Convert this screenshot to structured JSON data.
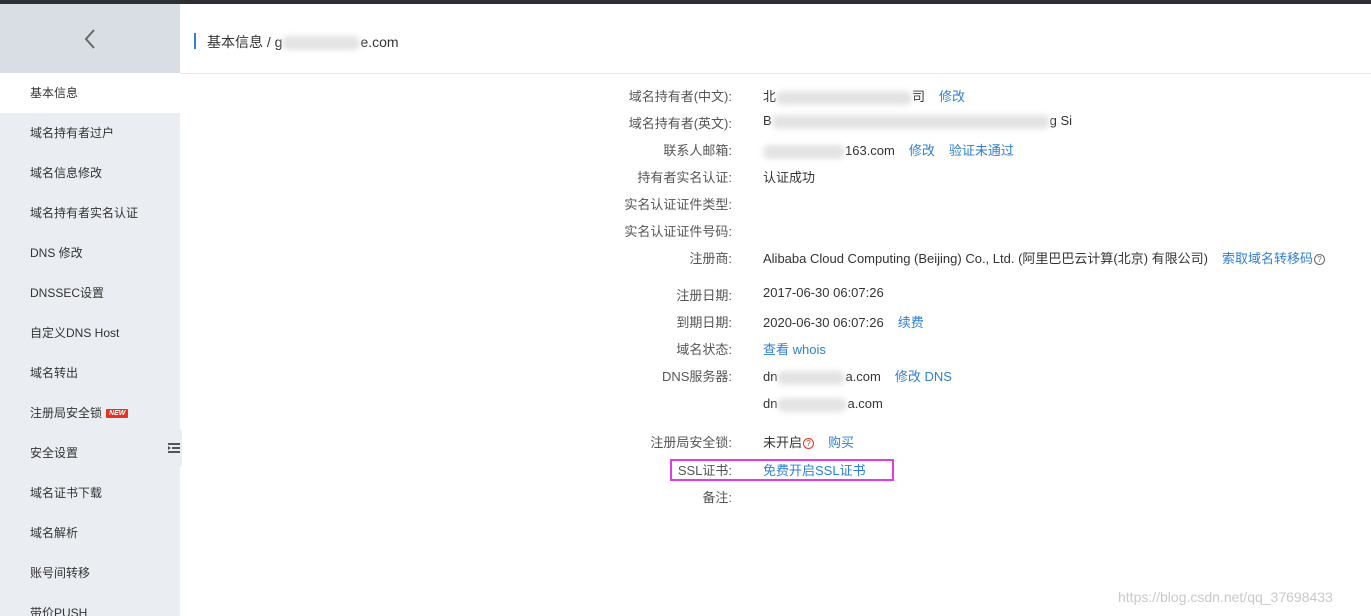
{
  "sidebar": {
    "items": [
      {
        "label": "基本信息"
      },
      {
        "label": "域名持有者过户"
      },
      {
        "label": "域名信息修改"
      },
      {
        "label": "域名持有者实名认证"
      },
      {
        "label": "DNS 修改"
      },
      {
        "label": "DNSSEC设置"
      },
      {
        "label": "自定义DNS Host"
      },
      {
        "label": "域名转出"
      },
      {
        "label": "注册局安全锁",
        "badge": "NEW"
      },
      {
        "label": "安全设置"
      },
      {
        "label": "域名证书下载"
      },
      {
        "label": "域名解析"
      },
      {
        "label": "账号间转移"
      },
      {
        "label": "带价PUSH"
      }
    ]
  },
  "header": {
    "breadcrumb_root": "基本信息",
    "separator": "/",
    "domain_prefix": "g",
    "domain_suffix": "e.com"
  },
  "info": {
    "owner_cn": {
      "label": "域名持有者(中文):",
      "prefix": "北",
      "suffix": "司",
      "action": "修改"
    },
    "owner_en": {
      "label": "域名持有者(英文):",
      "prefix": "B",
      "suffix": "g Si"
    },
    "email": {
      "label": "联系人邮箱:",
      "suffix": "163.com",
      "action1": "修改",
      "action2": "验证未通过"
    },
    "realname": {
      "label": "持有者实名认证:",
      "value": "认证成功"
    },
    "cert_type": {
      "label": "实名认证证件类型:"
    },
    "cert_no": {
      "label": "实名认证证件号码:"
    },
    "registrar": {
      "label": "注册商:",
      "value": "Alibaba Cloud Computing (Beijing) Co., Ltd. (阿里巴巴云计算(北京) 有限公司)",
      "action": "索取域名转移码"
    },
    "reg_date": {
      "label": "注册日期:",
      "value": "2017-06-30 06:07:26"
    },
    "exp_date": {
      "label": "到期日期:",
      "value": "2020-06-30 06:07:26",
      "action": "续费"
    },
    "status": {
      "label": "域名状态:",
      "action": "查看 whois"
    },
    "dns": {
      "label": "DNS服务器:",
      "ns1_prefix": "dn",
      "ns1_suffix": "a.com",
      "action": "修改 DNS",
      "ns2_prefix": "dn",
      "ns2_suffix": "a.com"
    },
    "lock": {
      "label": "注册局安全锁:",
      "value": "未开启",
      "action": "购买"
    },
    "ssl": {
      "label": "SSL证书:",
      "action": "免费开启SSL证书"
    },
    "remark": {
      "label": "备注:"
    }
  },
  "icons": {
    "back": "chevron-left-icon",
    "help": "question-circle-icon",
    "collapse": "collapse-menu-icon"
  },
  "colors": {
    "link": "#2f7fd6",
    "highlight": "#e23ce6",
    "badge": "#e8311f"
  },
  "watermark": "https://blog.csdn.net/qq_37698433"
}
